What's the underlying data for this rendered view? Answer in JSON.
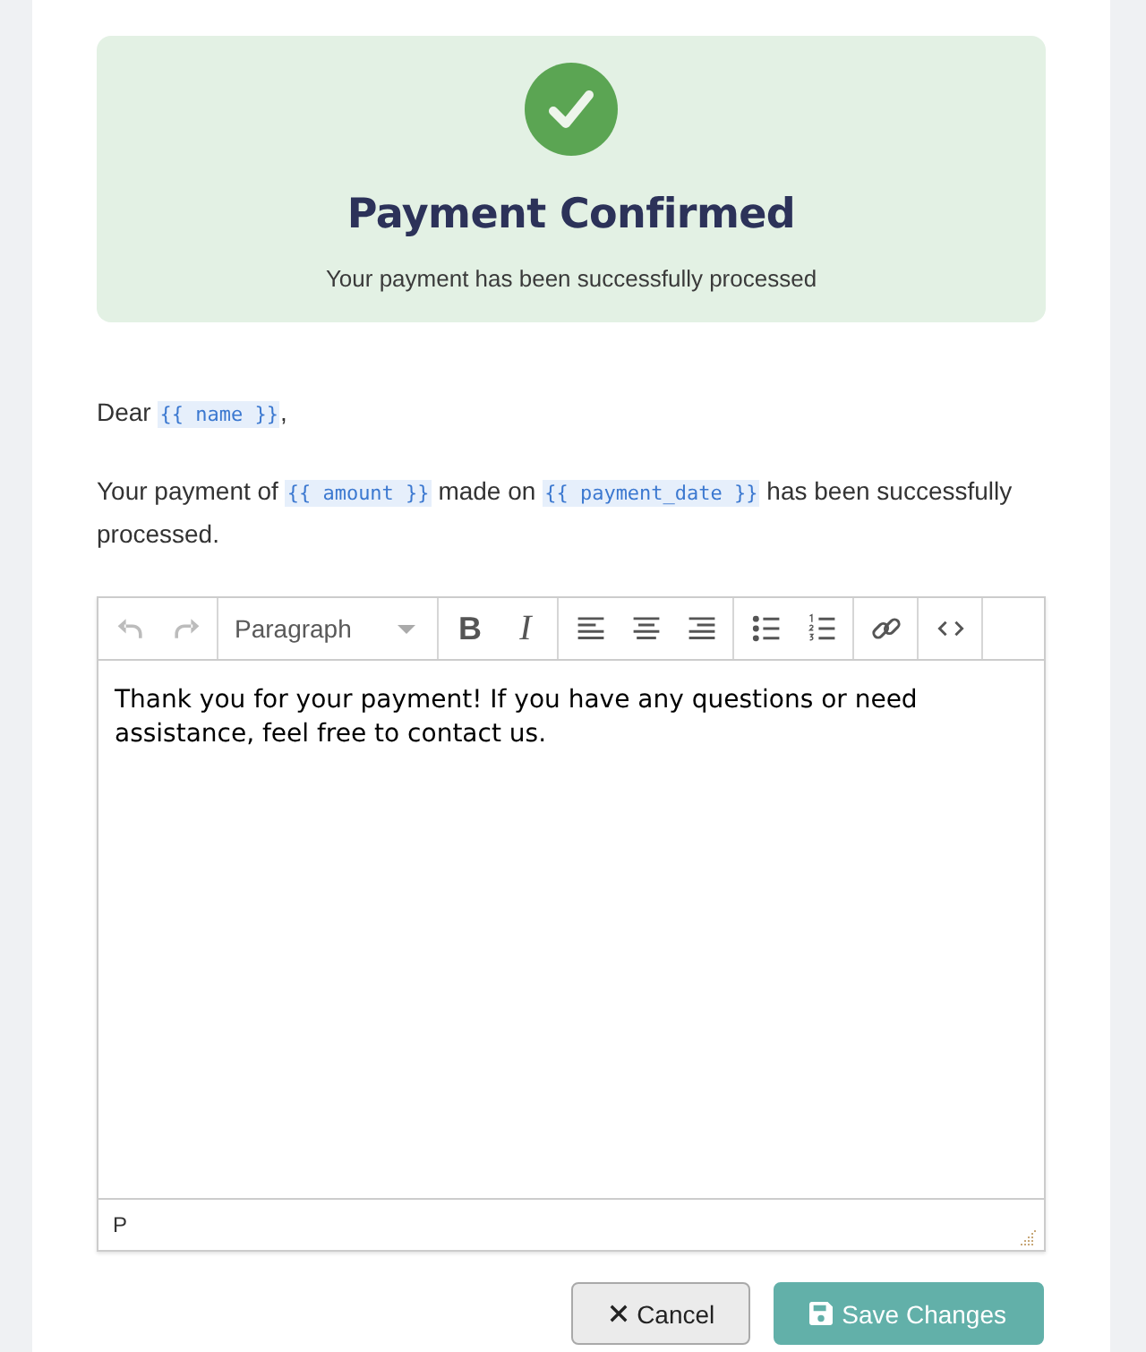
{
  "confirmation": {
    "title": "Payment Confirmed",
    "message": "Your payment has been successfully processed"
  },
  "body": [
    {
      "parts": [
        {
          "kind": "text",
          "text": "Dear "
        },
        {
          "kind": "variable",
          "text": "{{ name }}"
        },
        {
          "kind": "text",
          "text": ","
        }
      ]
    },
    {
      "parts": [
        {
          "kind": "text",
          "text": "Your payment of "
        },
        {
          "kind": "variable",
          "text": "{{ amount }}"
        },
        {
          "kind": "text",
          "text": " made on "
        },
        {
          "kind": "variable",
          "text": "{{ payment_date }}"
        },
        {
          "kind": "text",
          "text": " has been successfully processed."
        }
      ]
    }
  ],
  "editor": {
    "toolbar": [
      {
        "kind": "buttons",
        "buttons": [
          {
            "kind": "undo",
            "disabled": true
          },
          {
            "kind": "redo",
            "disabled": true
          }
        ]
      },
      {
        "kind": "select",
        "value": "Paragraph"
      },
      {
        "kind": "buttons",
        "buttons": [
          {
            "kind": "bold",
            "glyph": "B",
            "disabled": false
          },
          {
            "kind": "italic",
            "glyph": "I",
            "disabled": false
          }
        ]
      },
      {
        "kind": "buttons",
        "buttons": [
          {
            "kind": "align-left",
            "disabled": false
          },
          {
            "kind": "align-center",
            "disabled": false
          },
          {
            "kind": "align-right",
            "disabled": false
          }
        ]
      },
      {
        "kind": "buttons",
        "buttons": [
          {
            "kind": "bullet-list",
            "disabled": false
          },
          {
            "kind": "numbered-list",
            "disabled": false
          }
        ]
      },
      {
        "kind": "buttons",
        "buttons": [
          {
            "kind": "link",
            "disabled": false
          }
        ]
      },
      {
        "kind": "buttons",
        "buttons": [
          {
            "kind": "code",
            "disabled": false
          }
        ]
      }
    ],
    "content": "Thank you for your payment! If you have any questions or need assistance, feel free to contact us.",
    "path": "P"
  },
  "buttons": [
    {
      "kind": "cancel",
      "label": "Cancel"
    },
    {
      "kind": "save",
      "label": "Save Changes"
    }
  ]
}
